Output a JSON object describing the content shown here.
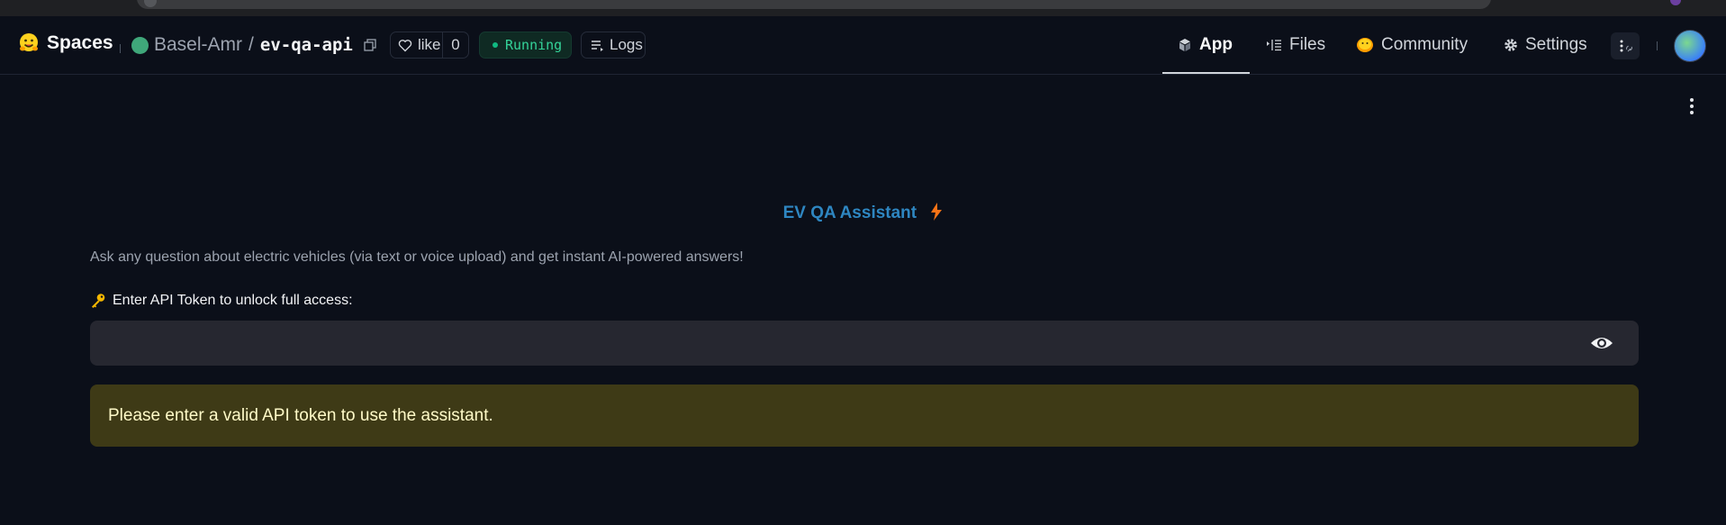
{
  "brand": {
    "label": "Spaces"
  },
  "repo": {
    "owner": "Basel-Amr",
    "separator": "/",
    "name": "ev-qa-api"
  },
  "like": {
    "label": "like",
    "count": "0"
  },
  "status": {
    "label": "Running",
    "color": "#34d399"
  },
  "logs": {
    "label": "Logs"
  },
  "nav": {
    "app": "App",
    "files": "Files",
    "community": "Community",
    "settings": "Settings"
  },
  "app": {
    "title": "EV QA Assistant",
    "title_color": "#2e86c1",
    "subtitle": "Ask any question about electric vehicles (via text or voice upload) and get instant AI-powered answers!",
    "token_label": "Enter API Token to unlock full access:",
    "token_value": "",
    "warning": "Please enter a valid API token to use the assistant."
  },
  "icons": {
    "brand": "huggingface-icon",
    "copy": "copy-icon",
    "like": "heart-icon",
    "logs": "logs-icon",
    "app": "cube-icon",
    "files": "files-icon",
    "community": "community-icon",
    "settings": "gear-icon",
    "more": "more-vertical-icon",
    "token": "key-icon",
    "show_password": "eye-icon",
    "bolt": "lightning-icon"
  }
}
